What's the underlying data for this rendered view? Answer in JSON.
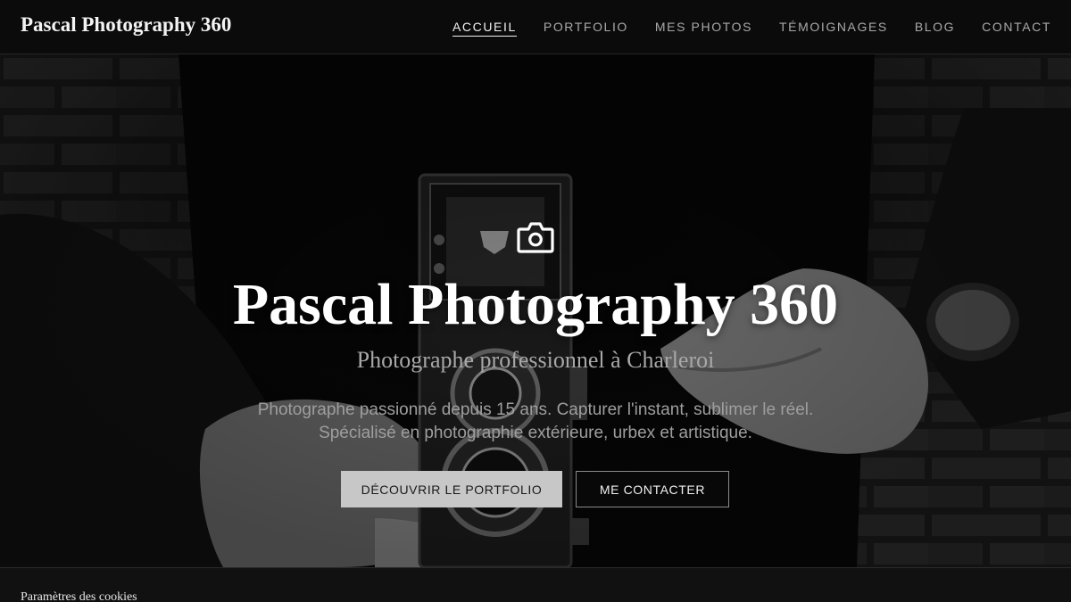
{
  "header": {
    "brand": "Pascal Photography 360",
    "nav": [
      {
        "label": "ACCUEIL",
        "active": true
      },
      {
        "label": "PORTFOLIO",
        "active": false
      },
      {
        "label": "MES PHOTOS",
        "active": false
      },
      {
        "label": "TÉMOIGNAGES",
        "active": false
      },
      {
        "label": "BLOG",
        "active": false
      },
      {
        "label": "CONTACT",
        "active": false
      }
    ]
  },
  "hero": {
    "icon": "camera-icon",
    "title": "Pascal Photography 360",
    "subtitle": "Photographe professionnel à Charleroi",
    "description": "Photographe passionné depuis 15 ans. Capturer l'instant, sublimer le réel. Spécialisé en photographie extérieure, urbex et artistique.",
    "primary_button": "DÉCOUVRIR LE PORTFOLIO",
    "secondary_button": "ME CONTACTER",
    "background_image": "black-and-white photo of hands holding a vintage twin-lens reflex camera in front of a brick wall"
  },
  "cookie_bar": {
    "title": "Paramètres des cookies"
  },
  "colors": {
    "background": "#0c0c0c",
    "header_bg": "#0b0b0b",
    "text_primary": "#ffffff",
    "text_muted": "#a8a8a8",
    "button_primary_bg": "#c7c7c7"
  }
}
